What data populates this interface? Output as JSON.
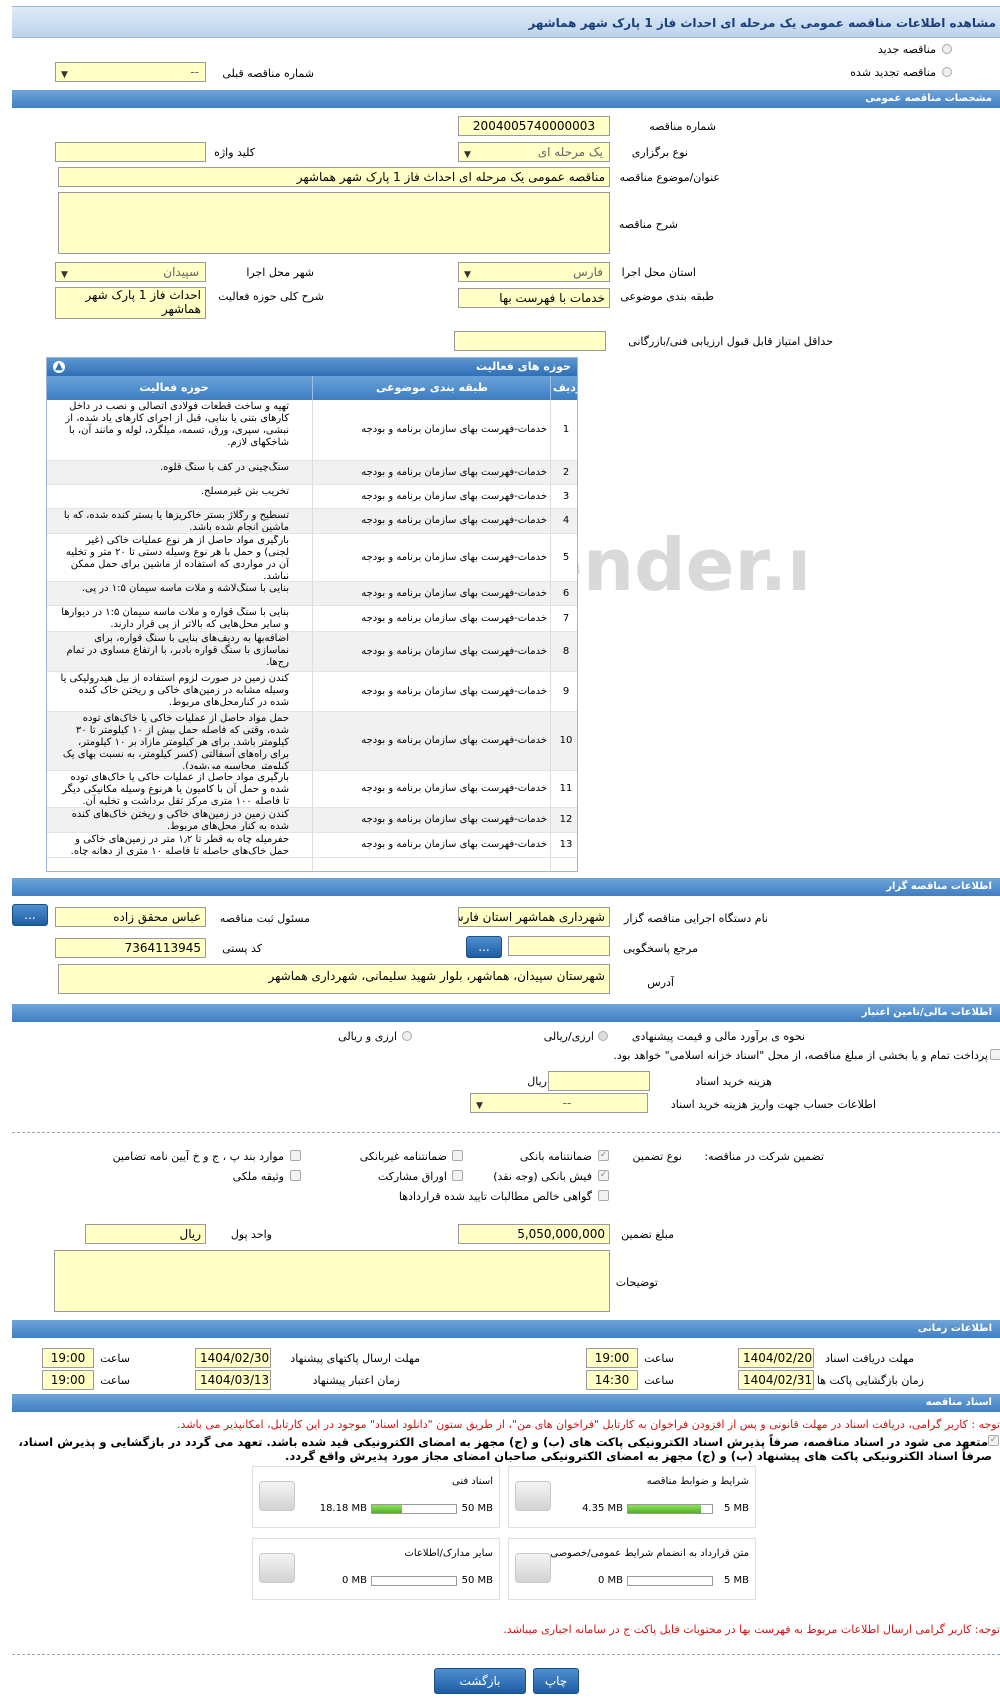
{
  "page_title": "مشاهده اطلاعات مناقصه عمومی یک مرحله ای احداث فاز 1 پارک شهر هماشهر",
  "mode": {
    "new_label": "مناقصه جدید",
    "renewed_label": "مناقصه تجدید شده",
    "prev_number_label": "شماره مناقصه قبلی",
    "prev_number_value": "--"
  },
  "general": {
    "header": "مشخصات مناقصه عمومی",
    "number_label": "شماره مناقصه",
    "number_value": "2004005740000003",
    "type_label": "نوع برگزاری",
    "type_value": "یک مرحله ای",
    "keyword_label": "کلید واژه",
    "keyword_value": "",
    "subject_label": "عنوان/موضوع مناقصه",
    "subject_value": "مناقصه عمومی یک مرحله ای احداث فاز 1 پارک شهر هماشهر",
    "desc_label": "شرح مناقصه",
    "desc_value": "",
    "province_label": "استان محل اجرا",
    "province_value": "فارس",
    "city_label": "شهر محل اجرا",
    "city_value": "سپیدان",
    "category_label": "طبقه بندی موضوعی",
    "category_value": "خدمات با فهرست بها",
    "scope_label": "شرح کلی حوزه فعالیت",
    "scope_value": "احداث فاز 1 پارک شهر هماشهر",
    "min_score_label": "حداقل امتیاز قابل قبول ارزیابی فنی/بازرگانی",
    "min_score_value": ""
  },
  "activities": {
    "header": "حوزه های فعالیت",
    "col_row": "ردیف",
    "col_category": "طبقه بندی موضوعی",
    "col_activity": "حوزه فعالیت",
    "rows": [
      {
        "n": "1",
        "cat": "خدمات-فهرست بهای سازمان برنامه و بودجه",
        "act": "تهیه و ساخت قطعات فولادی اتصالی و نصب در داخل کارهای بتنی یا بنایی، قبل از اجرای کارهای یاد شده، از نبشی، سپری، ورق، تسمه، میلگرد، لوله و مانند آن، با شاخکهای لازم."
      },
      {
        "n": "2",
        "cat": "خدمات-فهرست بهای سازمان برنامه و بودجه",
        "act": "سنگ‌چینی در کف با سنگ قلوه."
      },
      {
        "n": "3",
        "cat": "خدمات-فهرست بهای سازمان برنامه و بودجه",
        "act": "تخریب بتن غیرمسلح."
      },
      {
        "n": "4",
        "cat": "خدمات-فهرست بهای سازمان برنامه و بودجه",
        "act": "تسطیح و رگلاژ بستر خاکریزها یا بستر کنده شده، که با ماشین انجام شده باشد."
      },
      {
        "n": "5",
        "cat": "خدمات-فهرست بهای سازمان برنامه و بودجه",
        "act": "بارگیری مواد حاصل از هر نوع عملیات خاکی (غیر لجنی) و حمل با هر نوع وسیله دستی تا ۲۰ متر و تخلیه آن در مواردی که استفاده از ماشین برای حمل ممکن نباشد."
      },
      {
        "n": "6",
        "cat": "خدمات-فهرست بهای سازمان برنامه و بودجه",
        "act": "بنایی با سنگ‌لاشه و ملات ماسه سیمان ۱:۵ در پی."
      },
      {
        "n": "7",
        "cat": "خدمات-فهرست بهای سازمان برنامه و بودجه",
        "act": "بنایی با سنگ قواره و ملات ماسه سیمان ۱:۵ در دیوارها و سایر محل‌هایی که بالاتر از پی قرار دارند."
      },
      {
        "n": "8",
        "cat": "خدمات-فهرست بهای سازمان برنامه و بودجه",
        "act": "اضافه‌بها به ردیف‌های بنایی با سنگ قواره، برای نماسازی با سنگ قواره بادبر، با ارتفاع مساوی در تمام رج‌ها."
      },
      {
        "n": "9",
        "cat": "خدمات-فهرست بهای سازمان برنامه و بودجه",
        "act": "کندن زمین در صورت لزوم استفاده از بیل هیدرولیکی یا وسیله مشابه در زمین‌های خاکی و ریختن خاک کنده شده در کنارمحل‌های مربوط."
      },
      {
        "n": "10",
        "cat": "خدمات-فهرست بهای سازمان برنامه و بودجه",
        "act": "حمل مواد حاصل از عملیات خاکی یا خاک‌های توده شده، وقتی که فاصله حمل بیش از ۱۰ کیلومتر تا ۳۰ کیلومتر باشد. برای هر کیلومتر مازاد بر ۱۰ کیلومتر، برای راه‌های آسفالتی (کسر کیلومتر، به نسبت بهای یک کیلومتر محاسبه می‌شود)."
      },
      {
        "n": "11",
        "cat": "خدمات-فهرست بهای سازمان برنامه و بودجه",
        "act": "بارگیری مواد حاصل از عملیات خاکی یا خاک‌های توده شده و حمل آن با کامیون یا هرنوع وسیله مکانیکی دیگر تا فاصله ۱۰۰ متری مرکز ثقل برداشت و تخلیه آن."
      },
      {
        "n": "12",
        "cat": "خدمات-فهرست بهای سازمان برنامه و بودجه",
        "act": "کندن زمین در زمین‌های خاکی و ریختن خاک‌های کنده شده به کنار محل‌های مربوط."
      },
      {
        "n": "13",
        "cat": "خدمات-فهرست بهای سازمان برنامه و بودجه",
        "act": "حفرمیله چاه به قطر تا ۱٫۲ متر در زمین‌های خاکی و حمل خاک‌های حاصله تا فاصله ۱۰ متری از دهانه چاه."
      }
    ]
  },
  "organizer": {
    "header": "اطلاعات مناقصه گزار",
    "org_label": "نام دستگاه اجرایی مناقصه گزار",
    "org_value": "شهرداری هماشهر استان فارس",
    "officer_label": "مسئول ثبت مناقصه",
    "officer_value": "عباس محقق زاده",
    "officer_btn": "...",
    "ref_label": "مرجع پاسخگویی",
    "ref_value": "",
    "ref_btn": "...",
    "postal_label": "کد پستی",
    "postal_value": "7364113945",
    "address_label": "آدرس",
    "address_value": "شهرستان سپیدان، هماشهر، بلوار شهید سلیمانی، شهرداری هماشهر"
  },
  "finance": {
    "header": "اطلاعات مالی/تامین اعتبار",
    "estimate_label": "نحوه ی برآورد مالی و قیمت پیشنهادی",
    "opt_rial": "ارزی/ریالی",
    "opt_fx": "ارزی و ریالی",
    "treasury_text": "پرداخت تمام و یا بخشی از مبلغ مناقصه، از محل \"اسناد خزانه اسلامی\" خواهد بود.",
    "doc_fee_label": "هزینه خرید اسناد",
    "doc_fee_value": "",
    "doc_fee_unit": "ریال",
    "account_label": "اطلاعات حساب جهت واریز هزینه خرید اسناد",
    "account_value": "--"
  },
  "guarantee": {
    "participation_label": "تضمین شرکت در مناقصه:",
    "type_label": "نوع تضمین",
    "opt_bank": "ضمانتنامه بانکی",
    "opt_nonbank": "ضمانتنامه غیربانکی",
    "opt_clauses": "موارد بند پ ، ج و خ آیین نامه تضامین",
    "opt_cash": "فیش بانکی (وجه نقد)",
    "opt_bonds": "اوراق مشارکت",
    "opt_property": "وثیقه ملکی",
    "opt_receivables": "گواهی خالص مطالبات تایید شده قراردادها",
    "amount_label": "مبلغ تضمین",
    "amount_value": "5,050,000,000",
    "currency_label": "واحد پول",
    "currency_value": "ریال",
    "notes_label": "توضیحات",
    "notes_value": ""
  },
  "timing": {
    "header": "اطلاعات زمانی",
    "receive_label": "مهلت دریافت اسناد",
    "receive_date": "1404/02/20",
    "receive_time": "19:00",
    "submit_label": "مهلت ارسال پاکتهای پیشنهاد",
    "submit_date": "1404/02/30",
    "submit_time": "19:00",
    "open_label": "زمان بازگشایی پاکت ها",
    "open_date": "1404/02/31",
    "open_time": "14:30",
    "validity_label": "زمان اعتبار پیشنهاد",
    "validity_date": "1404/03/13",
    "validity_time": "19:00",
    "time_label": "ساعت"
  },
  "docs": {
    "header": "اسناد مناقصه",
    "note1": "توجه : کاربر گرامی، دریافت اسناد در مهلت قانونی و پس از افزودن فراخوان به کارتابل \"فراخوان های من\"، از طریق ستون \"دانلود اسناد\" موجود در این کارتابل، امکانپذیر می باشد.",
    "commit_line1": "متعهد می شود در اسناد مناقصه، صرفاً پذیرش اسناد الکترونیکی پاکت های (ب) و (ج) مجهز به امضای الکترونیکی قید شده باشد. تعهد می گردد در بازگشایی و پذیرش اسناد،",
    "commit_line2": "صرفاً اسناد الکترونیکی پاکت های پیشنهاد (ب) و (ج) مجهز به امضای الکترونیکی صاحبان امضای مجاز مورد پذیرش واقع گردد.",
    "files": [
      {
        "title": "شرایط و ضوابط مناقصه",
        "used": "4.35 MB",
        "max": "5 MB",
        "fill": 0.87
      },
      {
        "title": "اسناد فنی",
        "used": "18.18 MB",
        "max": "50 MB",
        "fill": 0.36
      },
      {
        "title": "متن قرارداد به انضمام شرایط عمومی/خصوصی",
        "used": "0 MB",
        "max": "5 MB",
        "fill": 0
      },
      {
        "title": "سایر مدارک/اطلاعات",
        "used": "0 MB",
        "max": "50 MB",
        "fill": 0
      }
    ],
    "note2": "توجه: کاربر گرامی ارسال اطلاعات مربوط به فهرست بها در محتویات فایل پاکت ج در سامانه اجباری میباشد."
  },
  "watermark": "AriaTender.neT",
  "buttons": {
    "back": "بازگشت",
    "print": "چاپ"
  }
}
